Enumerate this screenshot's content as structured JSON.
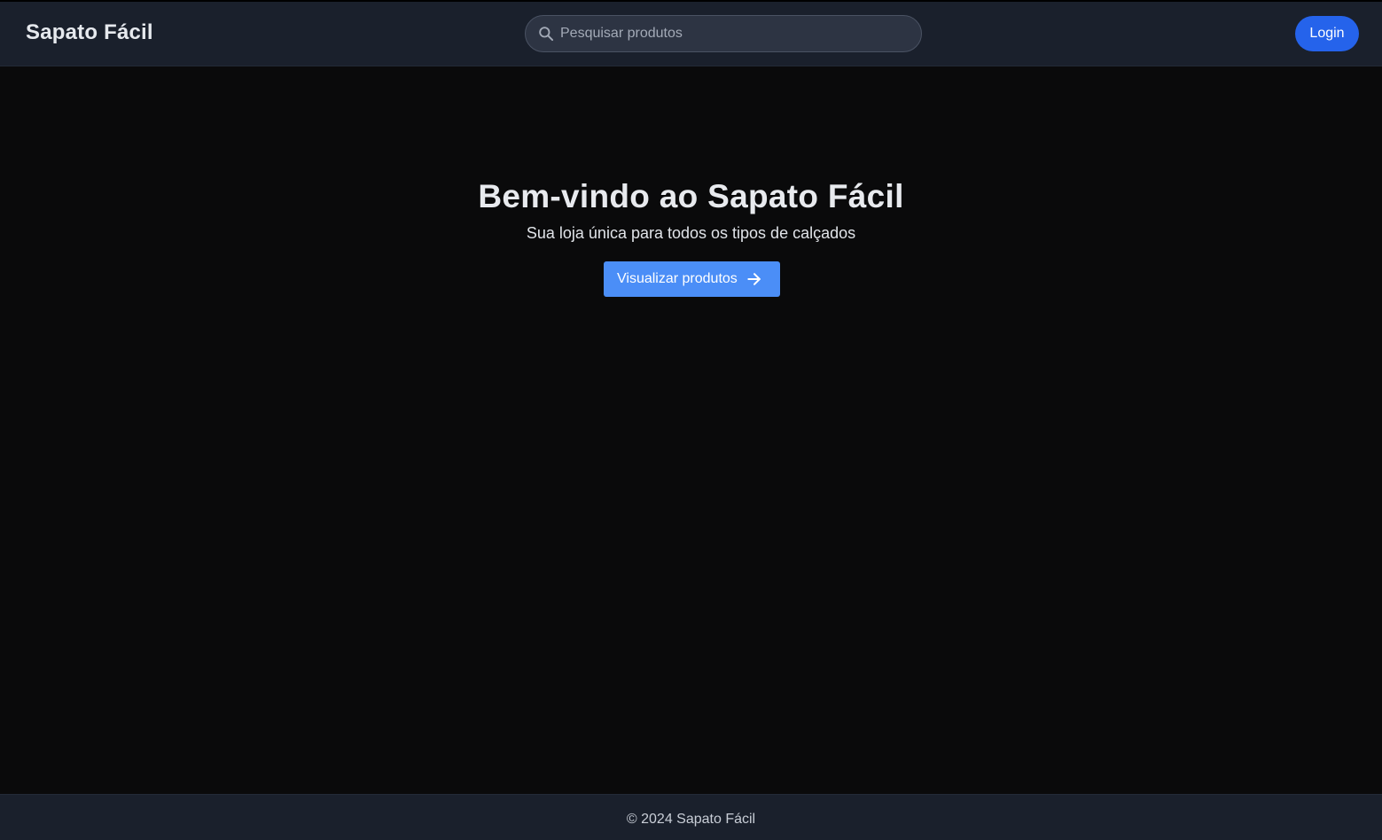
{
  "header": {
    "brand": "Sapato Fácil",
    "search": {
      "placeholder": "Pesquisar produtos",
      "value": "",
      "icon": "search-icon"
    },
    "login_label": "Login"
  },
  "hero": {
    "title": "Bem-vindo ao Sapato Fácil",
    "subtitle": "Sua loja única para todos os tipos de calçados",
    "cta_label": "Visualizar produtos",
    "cta_icon": "arrow-right-icon"
  },
  "footer": {
    "text": "© 2024 Sapato Fácil"
  },
  "colors": {
    "background": "#0a0a0b",
    "header_bg": "#1a202c",
    "login_button": "#2563eb",
    "cta_button": "#4b8ef7",
    "text": "#e8eaee"
  }
}
